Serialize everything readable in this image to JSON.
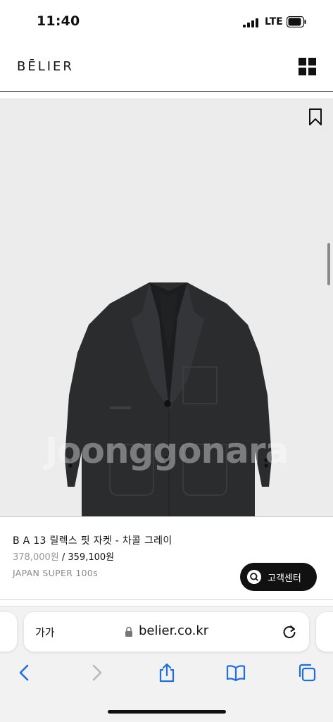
{
  "status_bar": {
    "time": "11:40",
    "network": "LTE"
  },
  "header": {
    "brand": "BĒLIER"
  },
  "product": {
    "watermark": "Joonggonara",
    "name": "B A 13 릴렉스 핏 자켓 - 차콜 그레이",
    "price_original": "378,000원",
    "price_separator": " / ",
    "price_sale": "359,100원",
    "material": "JAPAN SUPER 100s"
  },
  "customer_service": {
    "label": "고객센터"
  },
  "browser": {
    "text_size_label": "가가",
    "url": "belier.co.kr"
  },
  "colors": {
    "accent": "#111111",
    "image_bg": "#ececec",
    "jacket": "#2b2c2e"
  },
  "icons": [
    "signal-icon",
    "battery-icon",
    "menu-grid-icon",
    "bookmark-icon",
    "search-icon",
    "lock-icon",
    "reload-icon",
    "back-icon",
    "forward-icon",
    "share-icon",
    "bookmarks-icon",
    "tabs-icon"
  ]
}
